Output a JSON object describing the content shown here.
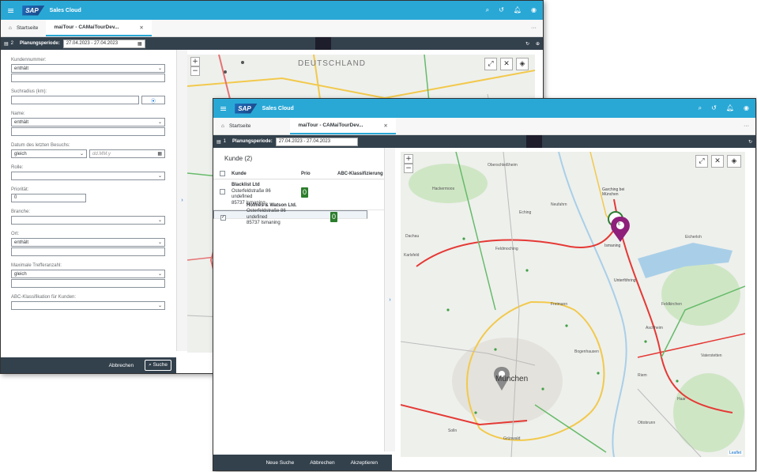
{
  "app": {
    "brand": "SAP",
    "title": "Sales Cloud"
  },
  "back_window": {
    "tabs": [
      {
        "label": "Startseite"
      },
      {
        "label": "maiTour - CAMaiTourDev..."
      }
    ],
    "toolbar": {
      "count": "2",
      "period_label": "Planungsperiode:",
      "period_value": "27.04.2023 - 27.04.2023"
    },
    "map_label": "DEUTSCHLAND",
    "form": {
      "kundennummer": {
        "label": "Kundennummer:",
        "operator": "enthält",
        "value": ""
      },
      "suchradius": {
        "label": "Suchradius (km):",
        "value": ""
      },
      "name": {
        "label": "Name:",
        "operator": "enthält",
        "value": ""
      },
      "datum": {
        "label": "Datum des letzten Besuchs:",
        "operator": "gleich",
        "placeholder": "dd.MM.y"
      },
      "rolle": {
        "label": "Rolle:",
        "value": ""
      },
      "prioritaet": {
        "label": "Priorität:",
        "value": "0"
      },
      "branche": {
        "label": "Branche:",
        "value": ""
      },
      "ort": {
        "label": "Ort:",
        "operator": "enthält",
        "value": ""
      },
      "treffer": {
        "label": "Maximale Trefferanzahl:",
        "operator": "gleich",
        "value": ""
      },
      "abc": {
        "label": "ABC-Klassifikation für Kunden:",
        "value": ""
      }
    },
    "footer": {
      "cancel": "Abbrechen",
      "search": "Suche"
    }
  },
  "front_window": {
    "tabs": [
      {
        "label": "Startseite"
      },
      {
        "label": "maiTour - CAMaiTourDev..."
      }
    ],
    "toolbar": {
      "count": "1",
      "period_label": "Planungsperiode:",
      "period_value": "27.04.2023 - 27.04.2023"
    },
    "list": {
      "title": "Kunde (2)",
      "columns": {
        "kunde": "Kunde",
        "prio": "Prio",
        "abc": "ABC-Klassifizierung"
      },
      "rows": [
        {
          "name": "Blacklist Ltd",
          "street": "Osterfeldstraße 86",
          "extra": "undefined",
          "city": "85737 Ismaning",
          "prio": "0",
          "checked": false
        },
        {
          "name": "Holmes & Watson Ltd.",
          "street": "Osterfeldstraße 86",
          "extra": "undefined",
          "city": "85737 Ismaning",
          "prio": "0",
          "checked": true
        }
      ]
    },
    "map": {
      "city": "München",
      "ismaning": "Ismaning",
      "garching": "Garching bei München",
      "unterfoehring": "Unterföhring",
      "pin_count": "6",
      "attribution": "Leaflet",
      "places": [
        "Oberschleißheim",
        "Hackermoos",
        "Eching",
        "Neufahrn",
        "Eicherloh",
        "Aschheim",
        "Karlsfeld",
        "Dachau",
        "Feldmoching",
        "Freimann",
        "Bogenhausen",
        "Haar",
        "Grünwald",
        "Solln",
        "Ottobrunn",
        "Vaterstetten",
        "Feldkirchen",
        "Riem"
      ]
    },
    "footer": {
      "new_search": "Neue Suche",
      "cancel": "Abbrechen",
      "accept": "Akzeptieren"
    }
  }
}
